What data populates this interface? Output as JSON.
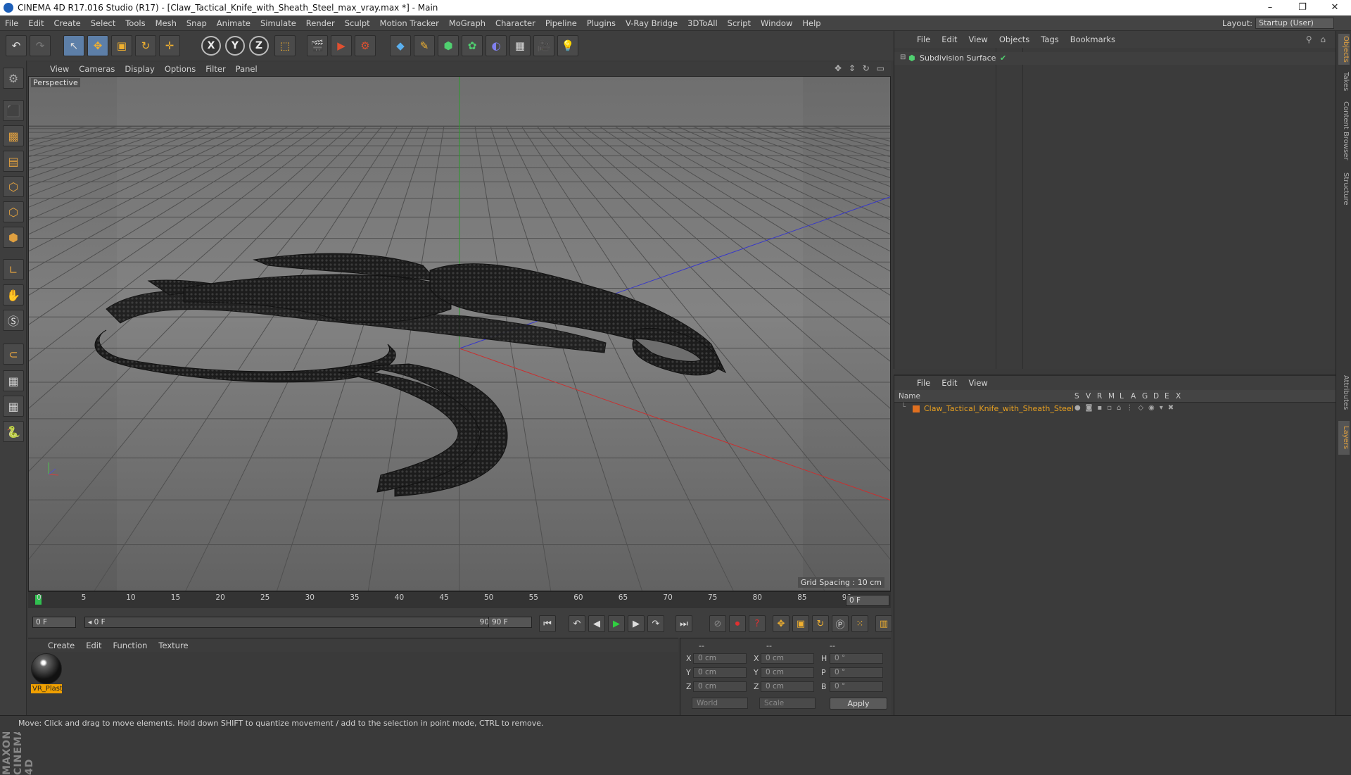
{
  "window": {
    "title": "CINEMA 4D R17.016 Studio (R17) - [Claw_Tactical_Knife_with_Sheath_Steel_max_vray.max *] - Main",
    "controls": [
      "–",
      "❐",
      "✕"
    ]
  },
  "menubar": {
    "items": [
      "File",
      "Edit",
      "Create",
      "Select",
      "Tools",
      "Mesh",
      "Snap",
      "Animate",
      "Simulate",
      "Render",
      "Sculpt",
      "Motion Tracker",
      "MoGraph",
      "Character",
      "Pipeline",
      "Plugins",
      "V-Ray Bridge",
      "3DToAll",
      "Script",
      "Window",
      "Help"
    ],
    "layout_label": "Layout:",
    "layout_value": "Startup (User)"
  },
  "toolbar": {
    "icons": [
      "undo-icon",
      "redo-icon",
      "select-icon",
      "move-icon",
      "scale-icon",
      "rotate-icon",
      "live-select-icon",
      "x-axis-icon",
      "y-axis-icon",
      "z-axis-icon",
      "coordinate-system-icon",
      "render-view-icon",
      "render-picture-viewer-icon",
      "edit-render-settings-icon",
      "cube-icon",
      "pen-icon",
      "subdivision-icon",
      "cloner-icon",
      "deformer-icon",
      "floor-icon",
      "camera-icon",
      "light-icon"
    ],
    "axis_labels": [
      "X",
      "Y",
      "Z"
    ]
  },
  "left_tools": [
    "make-editable-icon",
    "model-mode-icon",
    "texture-mode-icon",
    "workplane-icon",
    "points-mode-icon",
    "edges-mode-icon",
    "polygons-mode-icon",
    "axis-mode-icon",
    "tweak-icon",
    "solo-icon",
    "snap-icon",
    "grid-snap-icon",
    "quantize-icon",
    "python-icon"
  ],
  "viewport": {
    "menu": [
      "View",
      "Cameras",
      "Display",
      "Options",
      "Filter",
      "Panel"
    ],
    "label": "Perspective",
    "grid_spacing": "Grid Spacing : 10 cm",
    "nav_icons": "✥ ⇕ ↻ ▭"
  },
  "timeline": {
    "ticks": [
      "0",
      "5",
      "10",
      "15",
      "20",
      "25",
      "30",
      "35",
      "40",
      "45",
      "50",
      "55",
      "60",
      "65",
      "70",
      "75",
      "80",
      "85",
      "90"
    ],
    "current_frame": "0 F",
    "start_field": "0 F",
    "range_start": "◂ 0 F",
    "range_end": "90 F ▸",
    "end_field": "90 F"
  },
  "materials": {
    "menu": [
      "Create",
      "Edit",
      "Function",
      "Texture"
    ],
    "items": [
      {
        "name": "VR_Plast"
      }
    ]
  },
  "coordinates": {
    "headers": [
      "--",
      "--",
      "--"
    ],
    "rows": [
      {
        "a": "X",
        "av": "0 cm",
        "b": "X",
        "bv": "0 cm",
        "c": "H",
        "cv": "0 °"
      },
      {
        "a": "Y",
        "av": "0 cm",
        "b": "Y",
        "bv": "0 cm",
        "c": "P",
        "cv": "0 °"
      },
      {
        "a": "Z",
        "av": "0 cm",
        "b": "Z",
        "bv": "0 cm",
        "c": "B",
        "cv": "0 °"
      }
    ],
    "mode": "World",
    "transform": "Scale",
    "apply": "Apply"
  },
  "status": "Move: Click and drag to move elements. Hold down SHIFT to quantize movement / add to the selection in point mode, CTRL to remove.",
  "objects": {
    "menu": [
      "File",
      "Edit",
      "View",
      "Objects",
      "Tags",
      "Bookmarks"
    ],
    "items": [
      {
        "name": "Subdivision Surface",
        "check": "✔"
      }
    ]
  },
  "layers": {
    "menu": [
      "File",
      "Edit",
      "View"
    ],
    "header_name": "Name",
    "columns": [
      "S",
      "V",
      "R",
      "M",
      "L",
      "A",
      "G",
      "D",
      "E",
      "X"
    ],
    "items": [
      {
        "name": "Claw_Tactical_Knife_with_Sheath_Steel",
        "color": "#e07020"
      }
    ]
  },
  "side_tabs": [
    "Objects",
    "Takes",
    "Content Browser",
    "Structure",
    "Attributes",
    "Layers"
  ],
  "brand": "MAXON CINEMA 4D"
}
